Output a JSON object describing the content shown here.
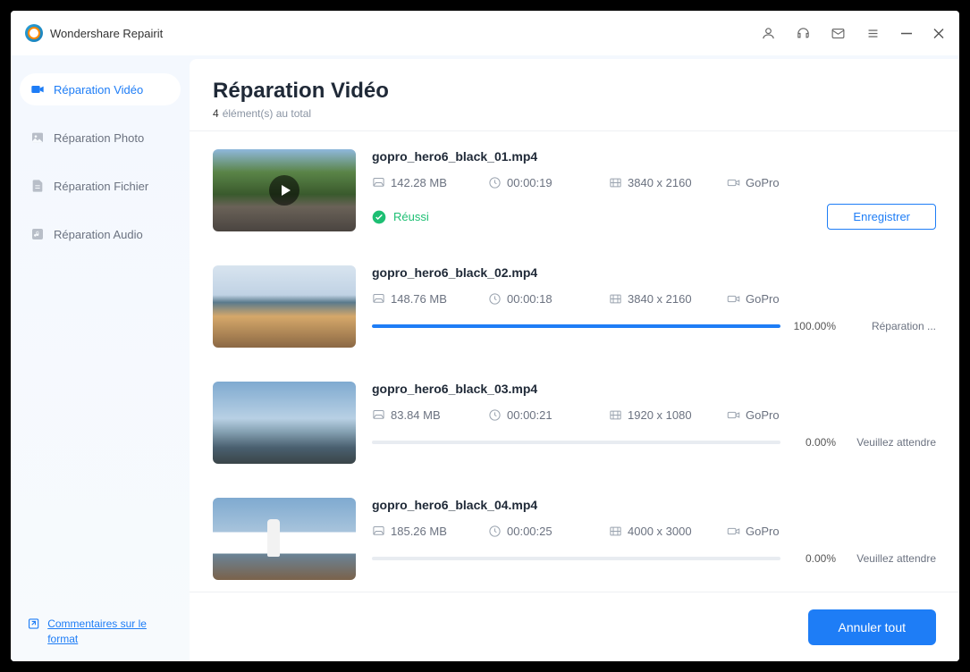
{
  "app": {
    "title": "Wondershare Repairit"
  },
  "sidebar": {
    "items": [
      {
        "label": "Réparation Vidéo",
        "icon": "video"
      },
      {
        "label": "Réparation Photo",
        "icon": "photo"
      },
      {
        "label": "Réparation Fichier",
        "icon": "file"
      },
      {
        "label": "Réparation Audio",
        "icon": "audio"
      }
    ],
    "feedback": "Commentaires sur le format"
  },
  "header": {
    "title": "Réparation Vidéo",
    "count": "4",
    "count_suffix": "élément(s) au total"
  },
  "items": [
    {
      "name": "gopro_hero6_black_01.mp4",
      "size": "142.28  MB",
      "duration": "00:00:19",
      "resolution": "3840 x 2160",
      "device": "GoPro",
      "state": "success",
      "status_text": "Réussi",
      "action_label": "Enregistrer"
    },
    {
      "name": "gopro_hero6_black_02.mp4",
      "size": "148.76  MB",
      "duration": "00:00:18",
      "resolution": "3840 x 2160",
      "device": "GoPro",
      "state": "progress",
      "percent": "100.00%",
      "progress": 100,
      "status_label": "Réparation ..."
    },
    {
      "name": "gopro_hero6_black_03.mp4",
      "size": "83.84  MB",
      "duration": "00:00:21",
      "resolution": "1920 x 1080",
      "device": "GoPro",
      "state": "progress",
      "percent": "0.00%",
      "progress": 0,
      "status_label": "Veuillez attendre"
    },
    {
      "name": "gopro_hero6_black_04.mp4",
      "size": "185.26  MB",
      "duration": "00:00:25",
      "resolution": "4000 x 3000",
      "device": "GoPro",
      "state": "progress",
      "percent": "0.00%",
      "progress": 0,
      "status_label": "Veuillez attendre"
    }
  ],
  "footer": {
    "cancel": "Annuler tout"
  }
}
